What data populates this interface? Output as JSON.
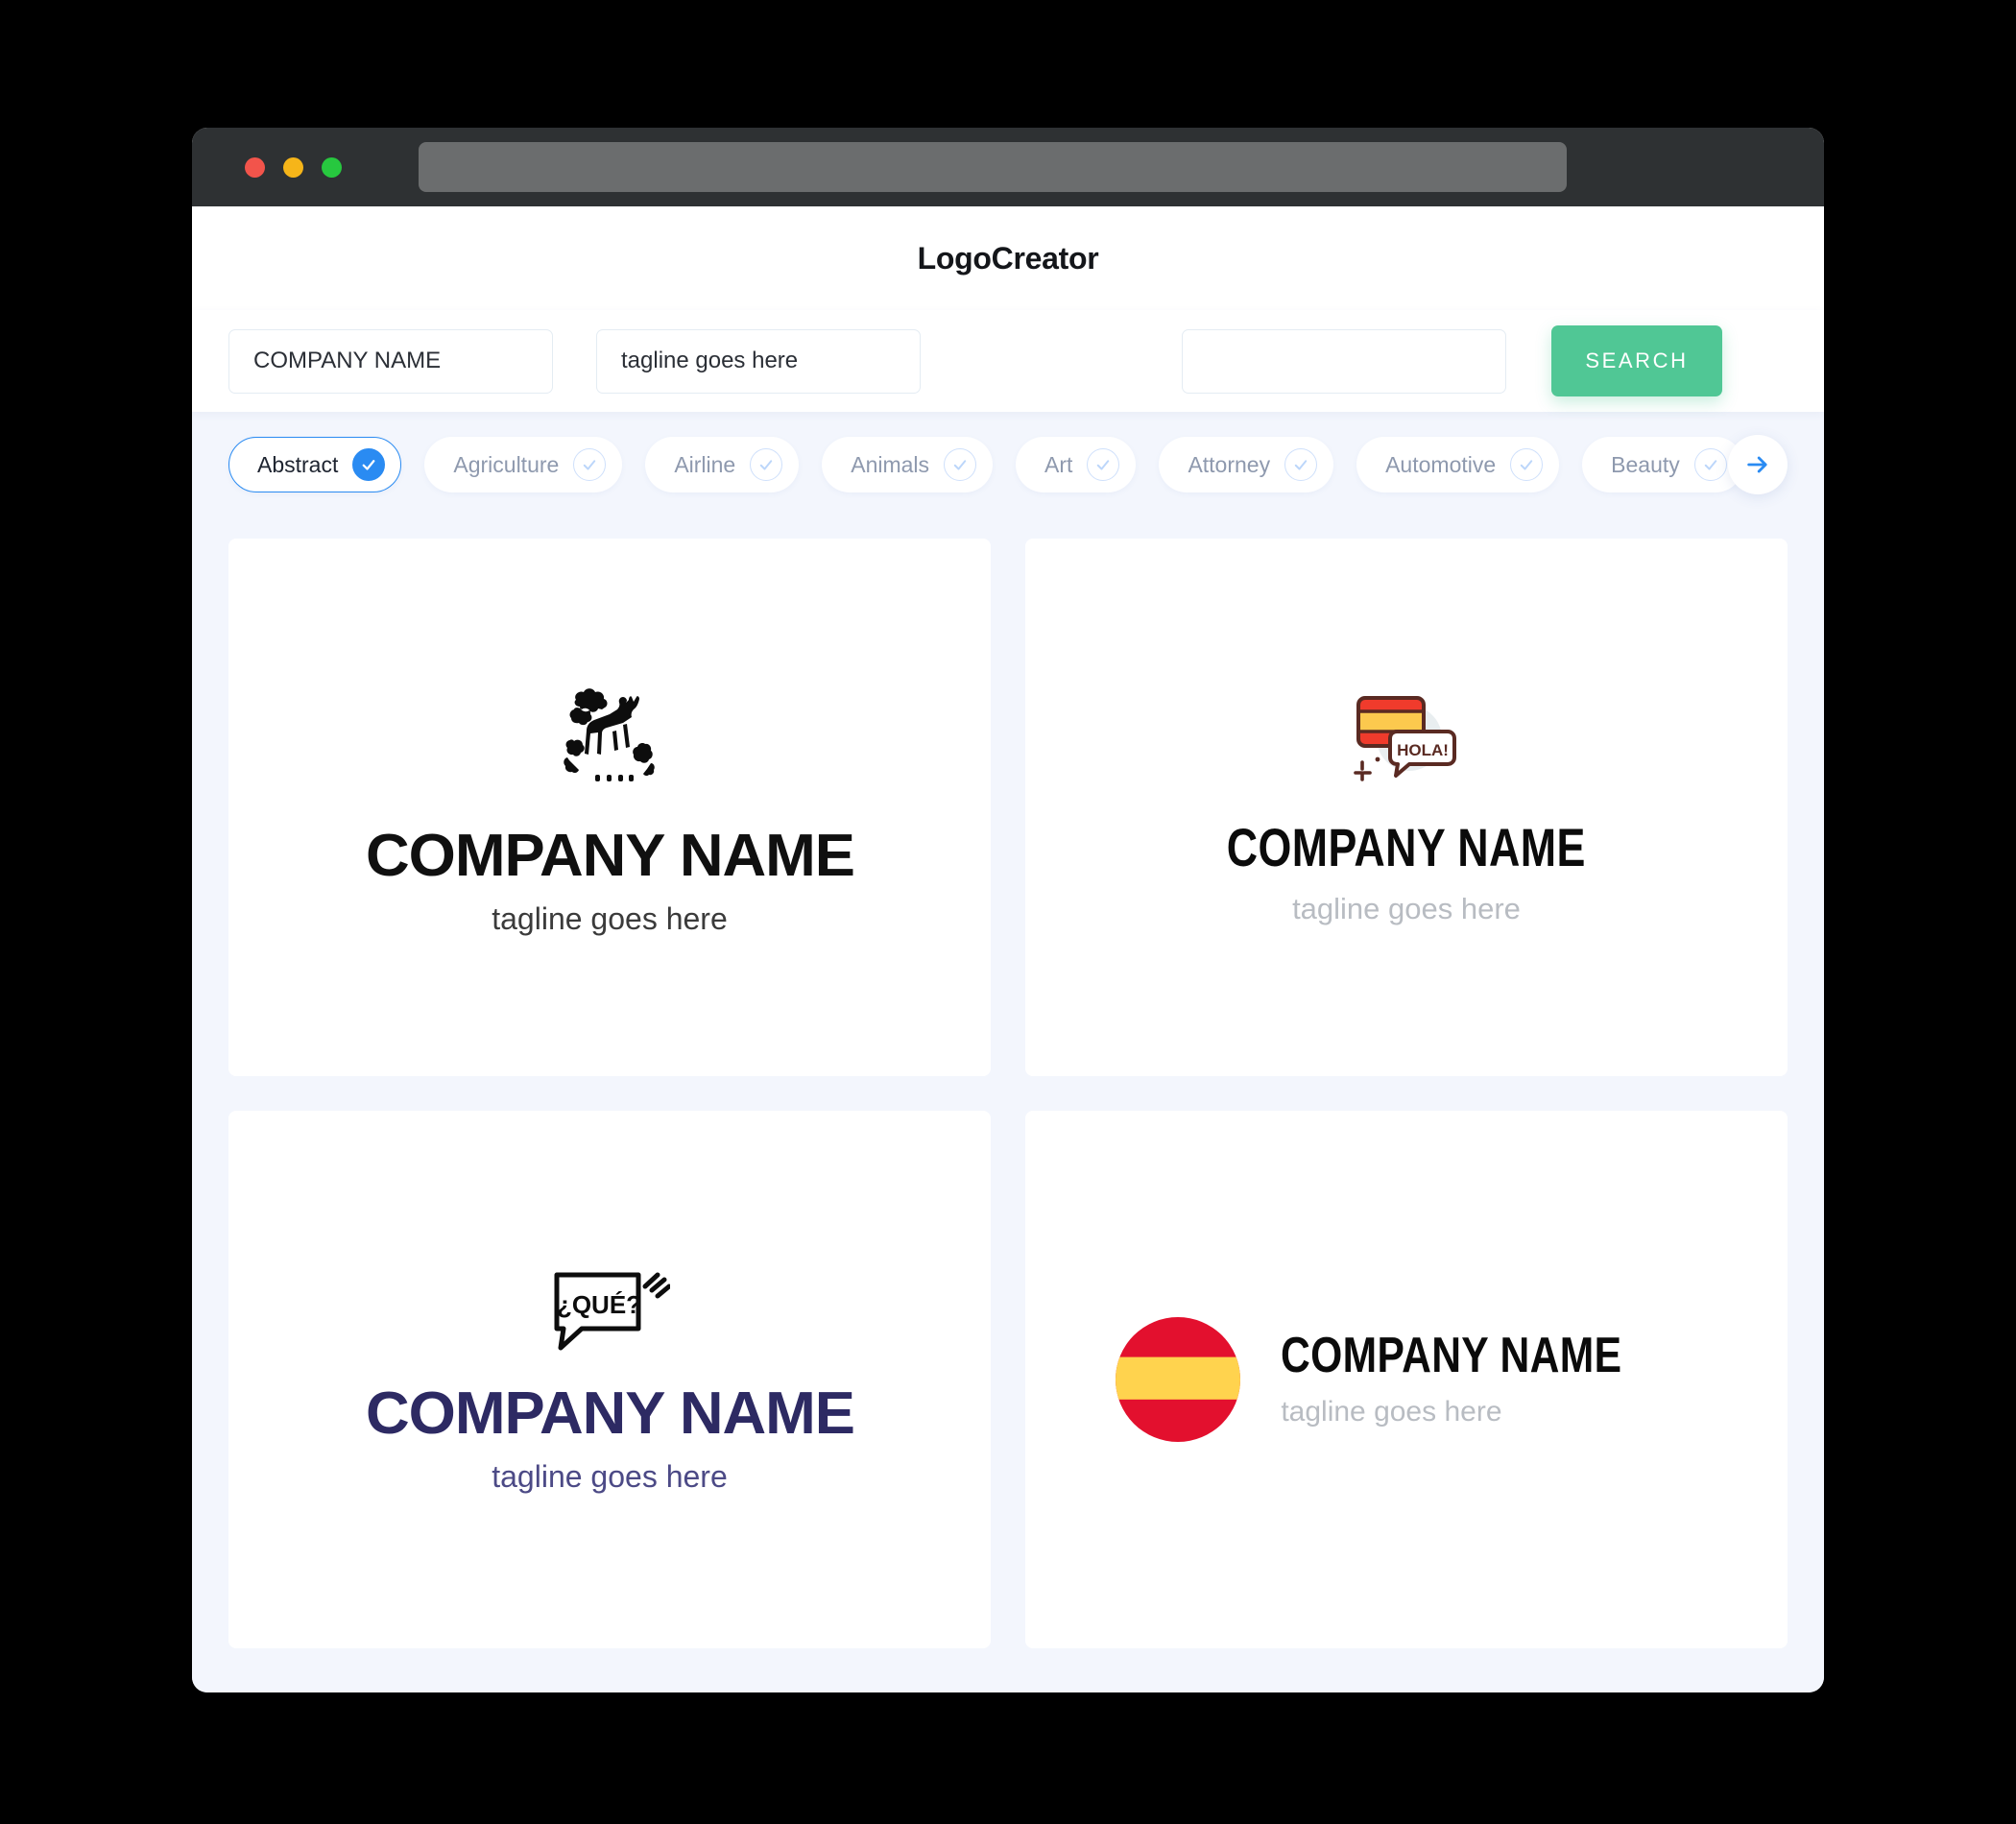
{
  "window": {
    "traffic_lights": [
      "close-red",
      "minimize-yellow",
      "maximize-green"
    ],
    "url_value": ""
  },
  "header": {
    "title": "LogoCreator"
  },
  "search": {
    "company_value": "COMPANY NAME",
    "company_placeholder": "COMPANY NAME",
    "tagline_value": "tagline goes here",
    "tagline_placeholder": "tagline goes here",
    "extra_value": "",
    "extra_placeholder": "",
    "button_label": "SEARCH",
    "button_color": "#50c795"
  },
  "filters": {
    "selected": "Abstract",
    "accent_color": "#2a8bf2",
    "next_icon": "arrow-right-icon",
    "chips": [
      {
        "label": "Abstract",
        "selected": true
      },
      {
        "label": "Agriculture",
        "selected": false
      },
      {
        "label": "Airline",
        "selected": false
      },
      {
        "label": "Animals",
        "selected": false
      },
      {
        "label": "Art",
        "selected": false
      },
      {
        "label": "Attorney",
        "selected": false
      },
      {
        "label": "Automotive",
        "selected": false
      },
      {
        "label": "Beauty",
        "selected": false
      }
    ]
  },
  "results": {
    "cards": [
      {
        "icon": "deer-foliage-icon",
        "name": "COMPANY NAME",
        "tagline": "tagline goes here",
        "name_color": "#101010",
        "tagline_color": "#3b3b3b",
        "layout": "stacked"
      },
      {
        "icon": "spanish-flag-hola-speech-bubble-icon",
        "bubble_text": "HOLA!",
        "name": "COMPANY NAME",
        "tagline": "tagline goes here",
        "name_color": "#0b0b0b",
        "tagline_color": "#b8bcc2",
        "layout": "stacked"
      },
      {
        "icon": "que-speech-bubble-icon",
        "bubble_text": "¿QUÉ?",
        "name": "COMPANY NAME",
        "tagline": "tagline goes here",
        "name_color": "#2d2a63",
        "tagline_color": "#4c4a86",
        "layout": "stacked"
      },
      {
        "icon": "spanish-flag-circle-icon",
        "name": "COMPANY NAME",
        "tagline": "tagline goes here",
        "name_color": "#0b0b0b",
        "tagline_color": "#b8bcc2",
        "layout": "horizontal"
      }
    ]
  }
}
